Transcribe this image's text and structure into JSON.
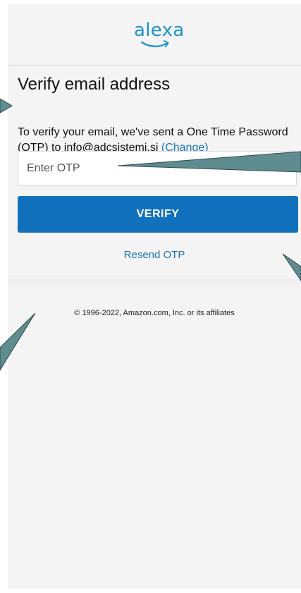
{
  "header": {
    "logo_text": "alexa",
    "logo_icon": "alexa-smile-logo"
  },
  "main": {
    "title": "Verify email address",
    "description": "To verify your email, we've sent a One Time Password (OTP) to info@adcsistemi.si",
    "change_link": "(Change)",
    "otp_placeholder": "Enter OTP",
    "verify_label": "VERIFY",
    "resend_label": "Resend OTP"
  },
  "footer": {
    "copyright": "© 1996-2022, Amazon.com, Inc. or its affiliates"
  },
  "colors": {
    "accent": "#1271bd",
    "link": "#1a73b8",
    "logo": "#1c93c8",
    "annotation_pointer": "#5e8c8f"
  }
}
